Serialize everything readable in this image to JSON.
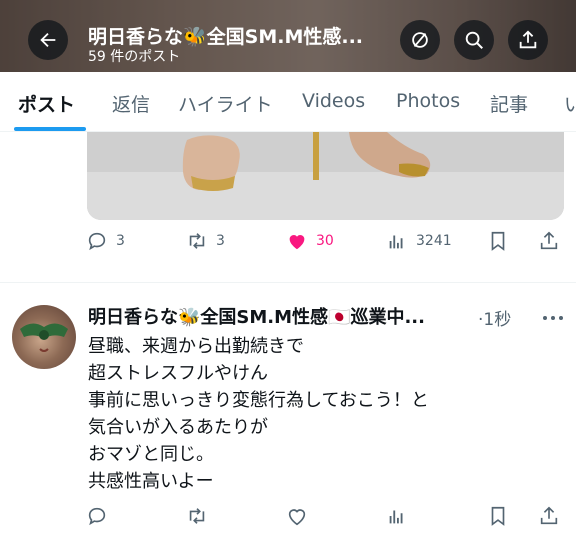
{
  "header": {
    "title": "明日香らな🐝全国SM.M性感...",
    "subtitle": "59 件のポスト"
  },
  "tabs": [
    {
      "label": "ポスト",
      "active": true
    },
    {
      "label": "返信"
    },
    {
      "label": "ハイライト"
    },
    {
      "label": "Videos"
    },
    {
      "label": "Photos"
    },
    {
      "label": "記事"
    },
    {
      "label": "い"
    }
  ],
  "tweet1": {
    "replies": "3",
    "reposts": "3",
    "likes": "30",
    "views": "3241",
    "like_color": "#f91880"
  },
  "tweet2": {
    "name": "明日香らな🐝全国SM.M性感🇯🇵巡業中...",
    "time": "·1秒",
    "lines": [
      "昼職、来週から出勤続きで",
      "超ストレスフルやけん",
      "事前に思いっきり変態行為しておこう！と",
      "気合いが入るあたりが",
      "おマゾと同じ。",
      "共感性高いよー"
    ]
  },
  "colors": {
    "accent": "#1d9bf0",
    "muted": "#536471",
    "text": "#0f1419"
  }
}
